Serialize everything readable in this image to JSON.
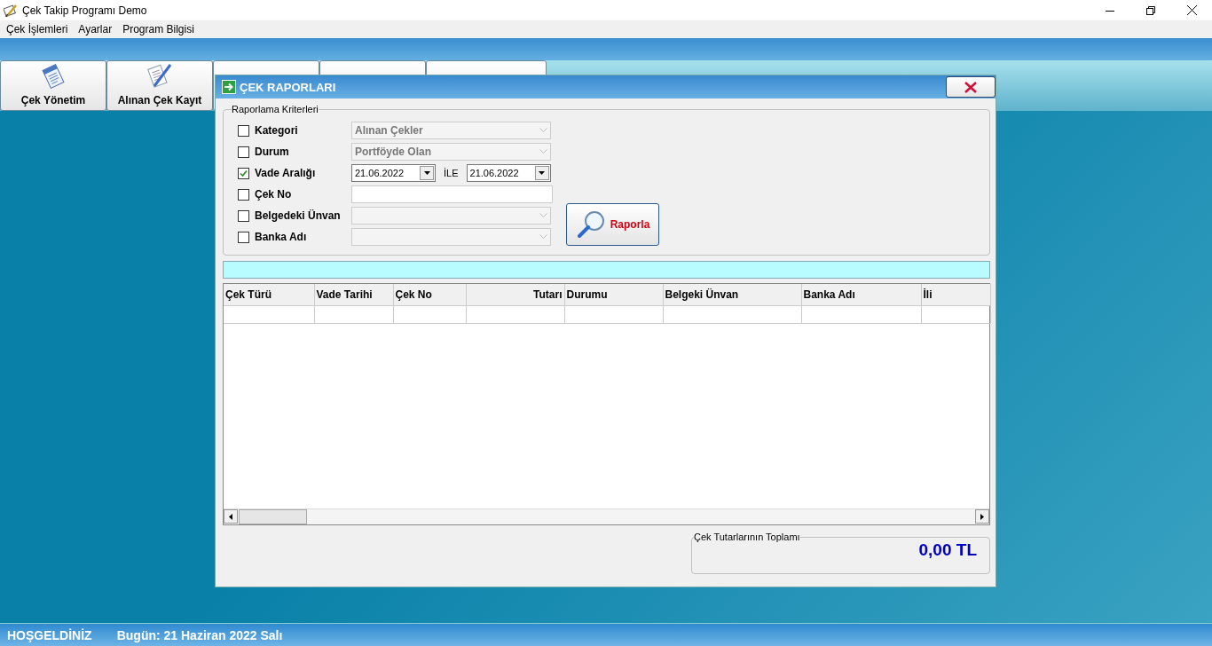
{
  "window": {
    "title": "Çek Takip Programı Demo"
  },
  "menu": [
    "Çek İşlemleri",
    "Ayarlar",
    "Program Bilgisi"
  ],
  "toolbar": [
    {
      "kind": "labeled",
      "label": "Çek Yönetim"
    },
    {
      "kind": "labeled",
      "label": "Alınan Çek Kayıt"
    },
    {
      "kind": "covered"
    },
    {
      "kind": "covered"
    },
    {
      "kind": "covered"
    }
  ],
  "dialog": {
    "title": "ÇEK RAPORLARI",
    "criteria": {
      "legend": "Raporlama Kriterleri",
      "rows": [
        {
          "label": "Kategori",
          "checked": false,
          "kind": "combo",
          "value": "Alınan Çekler",
          "disabled": true
        },
        {
          "label": "Durum",
          "checked": false,
          "kind": "combo",
          "value": "Portföyde Olan",
          "disabled": true
        },
        {
          "label": "Vade Aralığı",
          "checked": true,
          "kind": "date-range",
          "from": "21.06.2022",
          "separator": "İLE",
          "to": "21.06.2022"
        },
        {
          "label": "Çek No",
          "checked": false,
          "kind": "text"
        },
        {
          "label": "Belgedeki Ünvan",
          "checked": false,
          "kind": "combo",
          "disabled": true
        },
        {
          "label": "Banka Adı",
          "checked": false,
          "kind": "combo",
          "disabled": true
        }
      ]
    },
    "report_button": "Raporla",
    "table": {
      "columns": [
        {
          "label": "Çek Türü",
          "kind": "text"
        },
        {
          "label": "Vade Tarihi",
          "kind": "text"
        },
        {
          "label": "Çek No",
          "kind": "text"
        },
        {
          "label": "Tutarı",
          "kind": "amount"
        },
        {
          "label": "Durumu",
          "kind": "text"
        },
        {
          "label": "Belgeki Ünvan",
          "kind": "text"
        },
        {
          "label": "Banka Adı",
          "kind": "text"
        },
        {
          "label": "İli",
          "kind": "text"
        }
      ]
    },
    "total": {
      "legend": "Çek Tutarlarının Toplamı",
      "value": "0,00 TL"
    }
  },
  "status_bar": [
    "HOŞGELDİNİZ",
    "Bugün: 21 Haziran 2022 Salı"
  ]
}
